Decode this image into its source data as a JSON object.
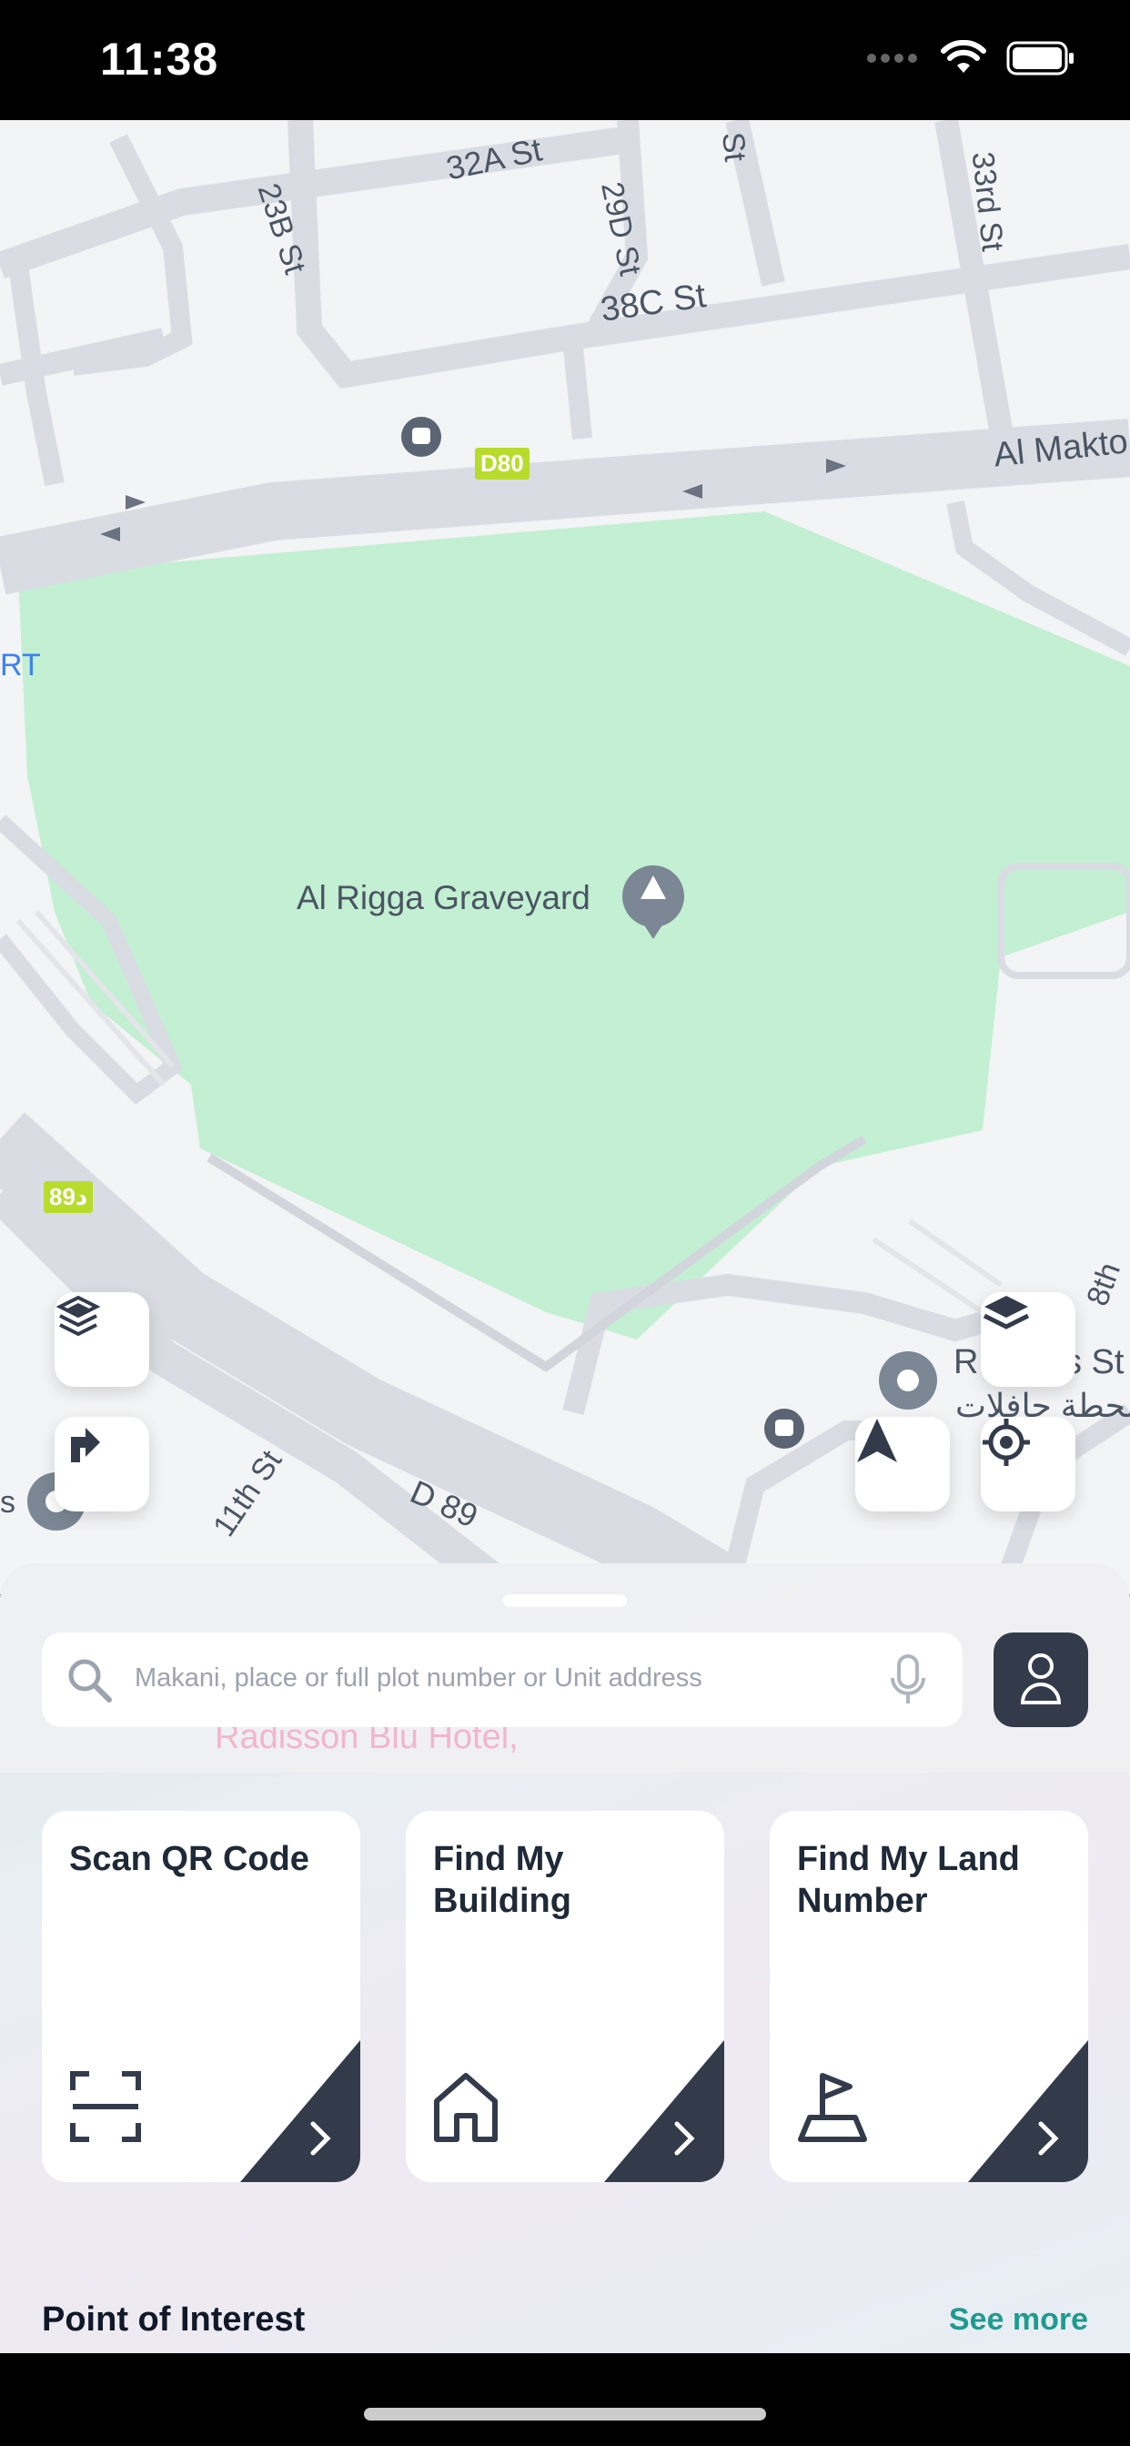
{
  "status_bar": {
    "time": "11:38"
  },
  "map": {
    "streets": [
      "32A St",
      "23B St",
      "29D St",
      "38C St",
      "33rd St",
      "Al Makto",
      "11th St",
      "D 89",
      "8th",
      "St",
      "R",
      "s St"
    ],
    "road_badges": [
      "D80",
      "89د"
    ],
    "poi_name": "Al Rigga Graveyard",
    "arabic_text": "محطة حافلات",
    "edge_text": "RT",
    "edge_text_2": "s",
    "faded_text": "Radisson Blu Hotel,"
  },
  "search": {
    "placeholder": "Makani, place or full plot number or Unit address"
  },
  "cards": [
    {
      "title": "Scan QR Code",
      "icon": "qr-scan-icon"
    },
    {
      "title": "Find My Building",
      "icon": "home-icon"
    },
    {
      "title": "Find My Land Number",
      "icon": "land-flag-icon"
    }
  ],
  "section": {
    "title": "Point of Interest",
    "see_more": "See more"
  },
  "colors": {
    "accent": "#1f9b8f",
    "dark": "#333b4b",
    "park": "#c3efd3",
    "road": "#d9dde3"
  }
}
